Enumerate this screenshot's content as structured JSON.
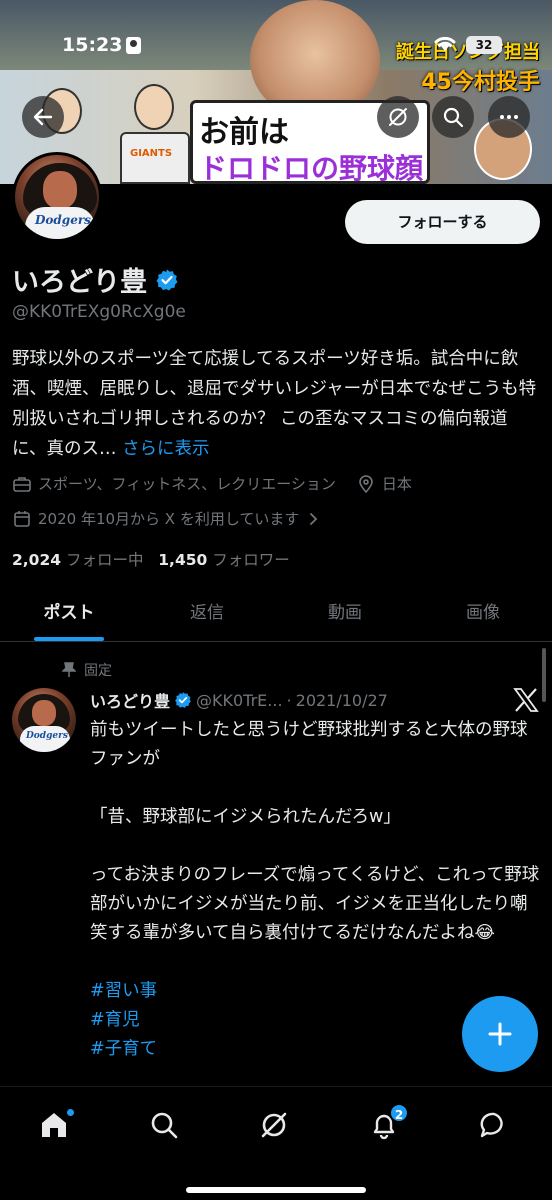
{
  "status_bar": {
    "time": "15:23",
    "battery": "32"
  },
  "banner": {
    "sign_line1": "お前は",
    "sign_line2": "ドロドロの野球顔",
    "caption1": "誕生日ソング担当",
    "caption2": "45今村投手",
    "jersey": "GIANTS"
  },
  "profile": {
    "follow_label": "フォローする",
    "name": "いろどり豊",
    "handle": "@KK0TrEXg0RcXg0e",
    "bio": "野球以外のスポーツ全て応援してるスポーツ好き垢。試合中に飲酒、喫煙、居眠りし、退屈でダサいレジャーが日本でなぜこうも特別扱いされゴリ押しされるのか？ この歪なマスコミの偏向報道に、真のス…",
    "bio_more": "さらに表示",
    "category": "スポーツ、フィットネス、レクリエーション",
    "location": "日本",
    "joined": "2020 年10月から X を利用しています",
    "following_count": "2,024",
    "following_label": "フォロー中",
    "followers_count": "1,450",
    "followers_label": "フォロワー",
    "avatar_shirt": "Dodgers"
  },
  "tabs": [
    {
      "label": "ポスト"
    },
    {
      "label": "返信"
    },
    {
      "label": "動画"
    },
    {
      "label": "画像"
    }
  ],
  "tweet": {
    "pinned_label": "固定",
    "name": "いろどり豊",
    "handle": "@KK0TrE...",
    "separator": "·",
    "date": "2021/10/27",
    "line1": "前もツイートしたと思うけど野球批判すると大体の野球ファンが",
    "line2": "「昔、野球部にイジメられたんだろw」",
    "line3": "ってお決まりのフレーズで煽ってくるけど、これって野球部がいかにイジメが当たり前、イジメを正当化したり嘲笑する輩が多いて自ら裏付けてるだけなんだよね😂",
    "tag1": "#習い事",
    "tag2": "#育児",
    "tag3": "#子育て"
  },
  "nav": {
    "notif_badge": "2"
  },
  "colors": {
    "accent": "#1d9bf0",
    "background": "#000000",
    "muted": "#71767b"
  }
}
